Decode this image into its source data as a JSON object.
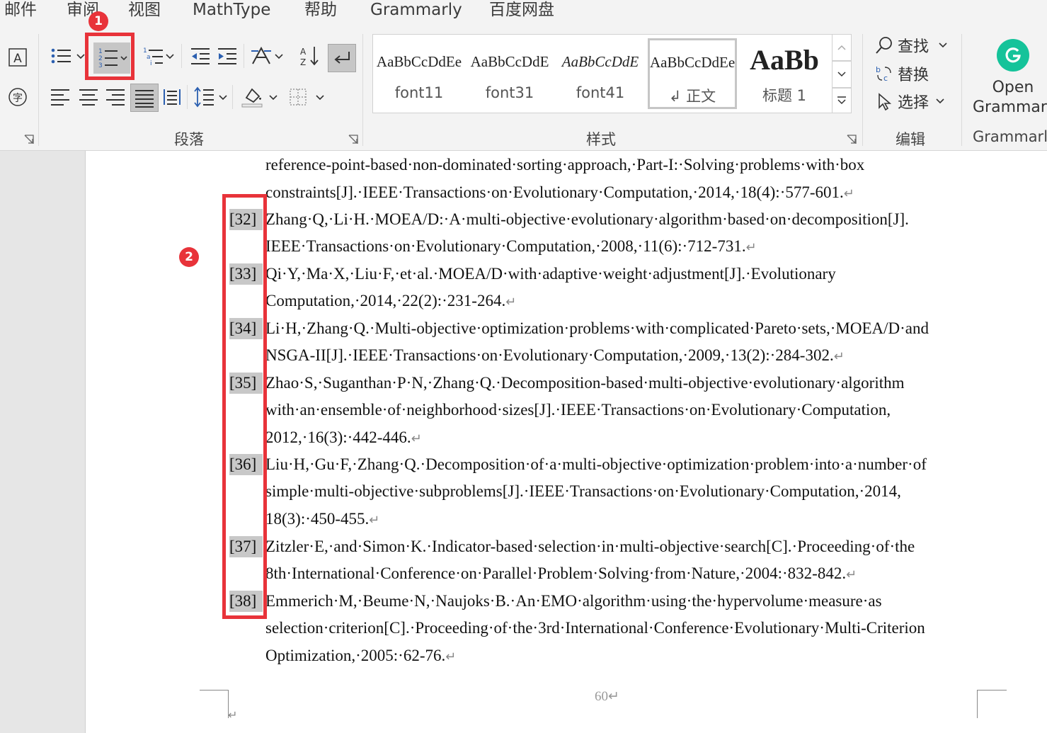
{
  "tabs": [
    "邮件",
    "审阅",
    "视图",
    "MathType",
    "帮助",
    "Grammarly",
    "百度网盘"
  ],
  "groups": {
    "paragraph": "段落",
    "styles": "样式",
    "editing": "编辑",
    "grammarly": "Grammarly"
  },
  "styles": [
    {
      "sample": "AaBbCcDdEe",
      "name": "font11"
    },
    {
      "sample": "AaBbCcDdE",
      "name": "font31"
    },
    {
      "sample": "AaBbCcDdE",
      "name": "font41"
    },
    {
      "sample": "AaBbCcDdEe",
      "name": "↲ 正文"
    },
    {
      "sample": "AaBb",
      "name": "标题 1"
    }
  ],
  "editing": {
    "find": "查找",
    "replace": "替换",
    "select": "选择"
  },
  "grammarly": {
    "open": "Open",
    "name": "Grammarly"
  },
  "badges": {
    "one": "1",
    "two": "2"
  },
  "doc": {
    "lines": [
      "reference-point-based·non-dominated·sorting·approach,·Part-I:·Solving·problems·with·box",
      "constraints[J].·IEEE·Transactions·on·Evolutionary·Computation,·2014,·18(4):·577-601.",
      "Zhang·Q,·Li·H.·MOEA/D:·A·multi-objective·evolutionary·algorithm·based·on·decomposition[J].",
      "IEEE·Transactions·on·Evolutionary·Computation,·2008,·11(6):·712-731.",
      "Qi·Y,·Ma·X,·Liu·F,·et·al.·MOEA/D·with·adaptive·weight·adjustment[J].·Evolutionary",
      "Computation,·2014,·22(2):·231-264.",
      "Li·H,·Zhang·Q.·Multi-objective·optimization·problems·with·complicated·Pareto·sets,·MOEA/D·and",
      "NSGA-II[J].·IEEE·Transactions·on·Evolutionary·Computation,·2009,·13(2):·284-302.",
      "Zhao·S,·Suganthan·P·N,·Zhang·Q.·Decomposition-based·multi-objective·evolutionary·algorithm",
      "with·an·ensemble·of·neighborhood·sizes[J].·IEEE·Transactions·on·Evolutionary·Computation,",
      "2012,·16(3):·442-446.",
      "Liu·H,·Gu·F,·Zhang·Q.·Decomposition·of·a·multi-objective·optimization·problem·into·a·number·of",
      "simple·multi-objective·subproblems[J].·IEEE·Transactions·on·Evolutionary·Computation,·2014,",
      "18(3):·450-455.",
      "Zitzler·E,·and·Simon·K.·Indicator-based·selection·in·multi-objective·search[C].·Proceeding·of·the",
      "8th·International·Conference·on·Parallel·Problem·Solving·from·Nature,·2004:·832-842.",
      "Emmerich·M,·Beume·N,·Naujoks·B.·An·EMO·algorithm·using·the·hypervolume·measure·as",
      "selection·criterion[C].·Proceeding·of·the·3rd·International·Conference·Evolutionary·Multi-Criterion",
      "Optimization,·2005:·62-76."
    ],
    "numbers": [
      "[32]",
      "[33]",
      "[34]",
      "[35]",
      "[36]",
      "[37]",
      "[38]"
    ],
    "paragraph_mark": "↵",
    "page_number": "60↵"
  },
  "colors": {
    "annotation": "#e8333a",
    "grammarly": "#15c39a"
  }
}
